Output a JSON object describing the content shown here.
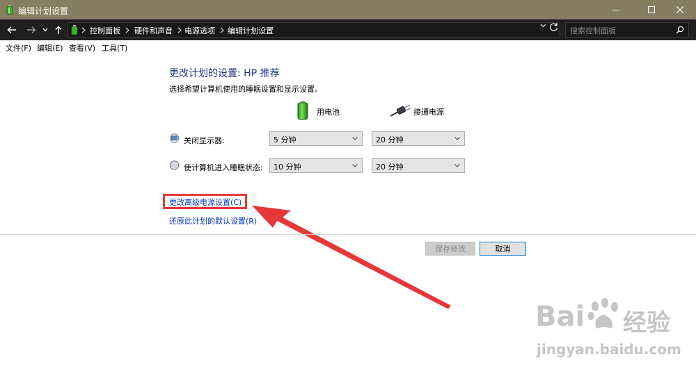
{
  "window": {
    "title": "编辑计划设置",
    "title_bar_color": "#877d60"
  },
  "address_bar": {
    "crumbs": [
      "控制面板",
      "硬件和声音",
      "电源选项",
      "编辑计划设置"
    ],
    "search_placeholder": "搜索控制面板"
  },
  "menu": {
    "items": [
      "文件(F)",
      "编辑(E)",
      "查看(V)",
      "工具(T)"
    ]
  },
  "content": {
    "heading": "更改计划的设置: HP 推荐",
    "subtitle": "选择希望计算机使用的睡眠设置和显示设置。",
    "columns": {
      "battery": {
        "label": "用电池",
        "icon": "battery-icon"
      },
      "plugged_in": {
        "label": "接通电源",
        "icon": "power-plug-icon"
      }
    },
    "rows": [
      {
        "label": "关闭显示器:",
        "icon": "monitor-icon",
        "battery_value": "5 分钟",
        "plugged_value": "20 分钟"
      },
      {
        "label": "使计算机进入睡眠状态:",
        "icon": "sleep-moon-icon",
        "battery_value": "10 分钟",
        "plugged_value": "20 分钟"
      }
    ],
    "links": {
      "advanced": "更改高级电源设置(C)",
      "restore": "还原此计划的默认设置(R)"
    },
    "buttons": {
      "save": "保存修改",
      "cancel": "取消"
    },
    "link_color": "#0033cc",
    "heading_color": "#1e3287",
    "annotation_color": "#e8373a"
  },
  "watermark": {
    "brand_left": "Bai",
    "brand_right": "经验",
    "url": "jingyan.baidu.com"
  }
}
